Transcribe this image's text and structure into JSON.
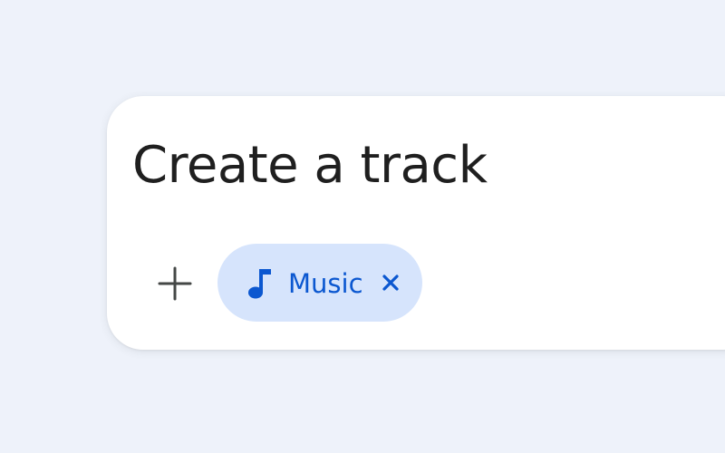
{
  "prompt": {
    "text": "Create a track"
  },
  "actions": {
    "add_icon": "plus-icon"
  },
  "chip": {
    "label": "Music",
    "icon": "music-note-icon",
    "remove_icon": "close-icon"
  },
  "colors": {
    "page_background": "#eef2fa",
    "card_background": "#ffffff",
    "text_primary": "#1f1f1f",
    "icon_secondary": "#444746",
    "chip_background": "#d6e4fc",
    "chip_foreground": "#0b57d0"
  }
}
